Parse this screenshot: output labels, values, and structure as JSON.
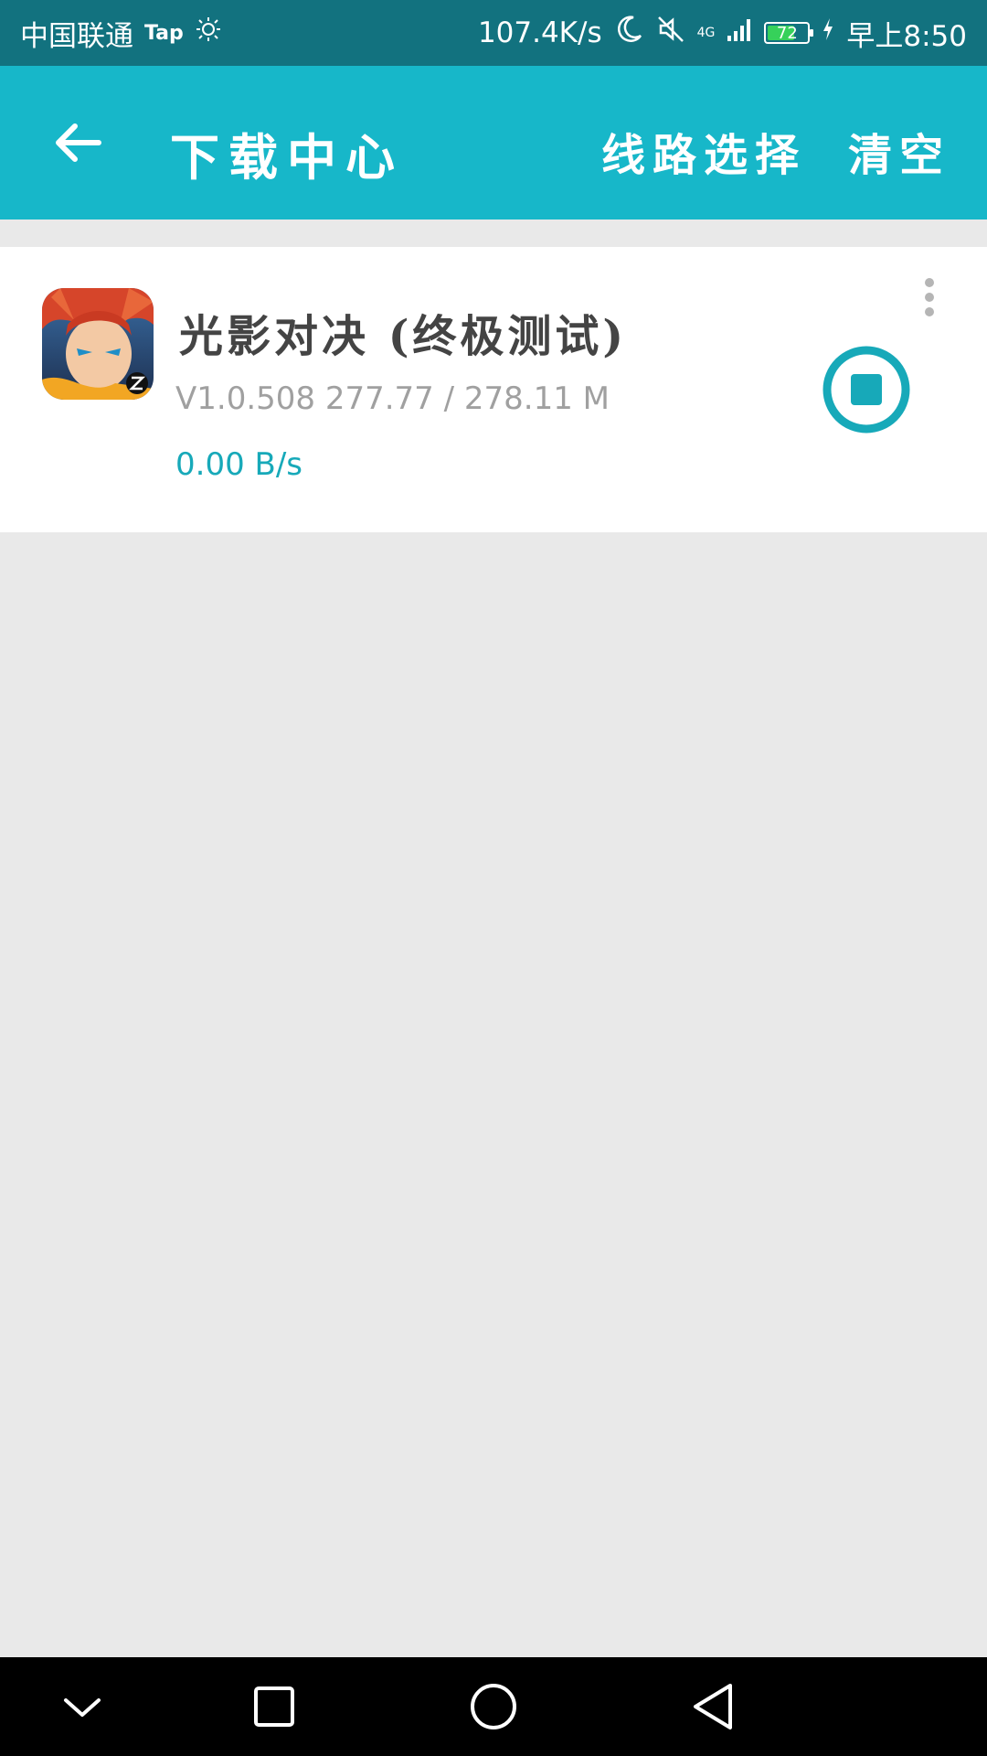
{
  "status_bar": {
    "carrier": "中国联通",
    "app_tag": "Tap",
    "net_speed": "107.4K/s",
    "network_type": "4G",
    "battery": "72",
    "battery_percent": 72,
    "time": "早上8:50",
    "icons": [
      "sun-icon",
      "moon-icon",
      "mute-icon",
      "signal-icon",
      "battery-icon",
      "charging-icon"
    ]
  },
  "app_bar": {
    "title": "下载中心",
    "route_select": "线路选择",
    "clear": "清空",
    "accent_color": "#17b7c9"
  },
  "downloads": [
    {
      "name": "光影对决 (终极测试)",
      "meta": "V1.0.508 277.77 / 278.11 M",
      "speed": "0.00 B/s"
    }
  ],
  "nav_bar": {
    "icons": [
      "chevron-down-icon",
      "recent-apps-icon",
      "home-icon",
      "back-icon"
    ]
  }
}
